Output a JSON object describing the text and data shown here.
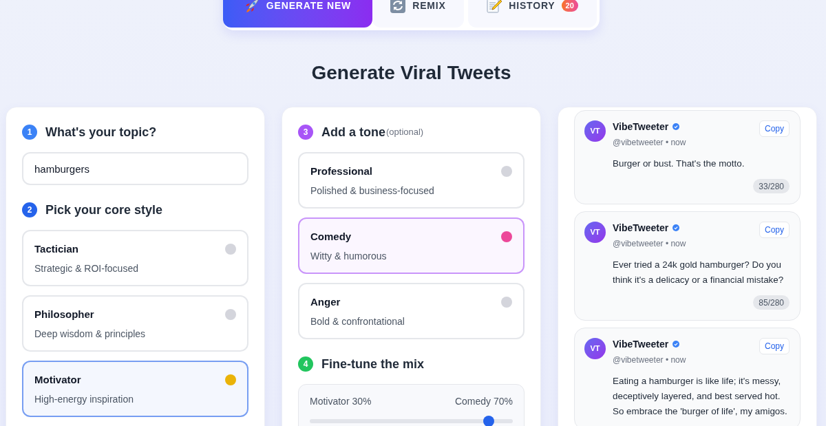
{
  "tabs": [
    {
      "label": "GENERATE NEW",
      "selected": true
    },
    {
      "label": "REMIX",
      "selected": false
    },
    {
      "label": "HISTORY",
      "selected": false,
      "badge": "20"
    }
  ],
  "title": "Generate Viral Tweets",
  "columns": [
    {
      "sections": [
        {
          "kind": "input",
          "step": {
            "number": "1",
            "color": "#3b82f6"
          },
          "heading": "What's your topic?",
          "value": "hamburgers"
        },
        {
          "kind": "options",
          "step": {
            "number": "2",
            "color": "#2563eb"
          },
          "heading": "Pick your core style",
          "options": [
            {
              "name": "Tactician",
              "description": "Strategic & ROI-focused",
              "selected": false
            },
            {
              "name": "Philosopher",
              "description": "Deep wisdom & principles",
              "selected": false
            },
            {
              "name": "Motivator",
              "description": "High-energy inspiration",
              "selected": true,
              "color": "#eab308"
            }
          ]
        }
      ]
    },
    {
      "sections": [
        {
          "kind": "options",
          "step": {
            "number": "3",
            "color": "#a855f7"
          },
          "heading": "Add a tone",
          "note": "(optional)",
          "options": [
            {
              "name": "Professional",
              "description": "Polished & business-focused",
              "selected": false
            },
            {
              "name": "Comedy",
              "description": "Witty & humorous",
              "selected": true,
              "color": "#ec4899"
            },
            {
              "name": "Anger",
              "description": "Bold & confrontational",
              "selected": false
            }
          ]
        },
        {
          "kind": "slider",
          "step": {
            "number": "4",
            "color": "#22c55e"
          },
          "heading": "Fine-tune the mix",
          "left_label": "Motivator 30%",
          "right_label": "Comedy 70%",
          "level": 0.88
        }
      ]
    }
  ],
  "tweets": [
    {
      "avatar": "VT",
      "name": "VibeTweeter",
      "verified": true,
      "meta": "@vibetweeter • now",
      "button": "Copy",
      "text": "Burger or bust. That's the motto.",
      "count": "33/280"
    },
    {
      "avatar": "VT",
      "name": "VibeTweeter",
      "verified": true,
      "meta": "@vibetweeter • now",
      "button": "Copy",
      "text": "Ever tried a 24k gold hamburger? Do you think it's a delicacy or a financial mistake?",
      "count": "85/280"
    },
    {
      "avatar": "VT",
      "name": "VibeTweeter",
      "verified": true,
      "meta": "@vibetweeter • now",
      "button": "Copy",
      "text": "Eating a hamburger is like life; it's messy, deceptively layered, and best served hot. So embrace the 'burger of life', my amigos."
    }
  ]
}
